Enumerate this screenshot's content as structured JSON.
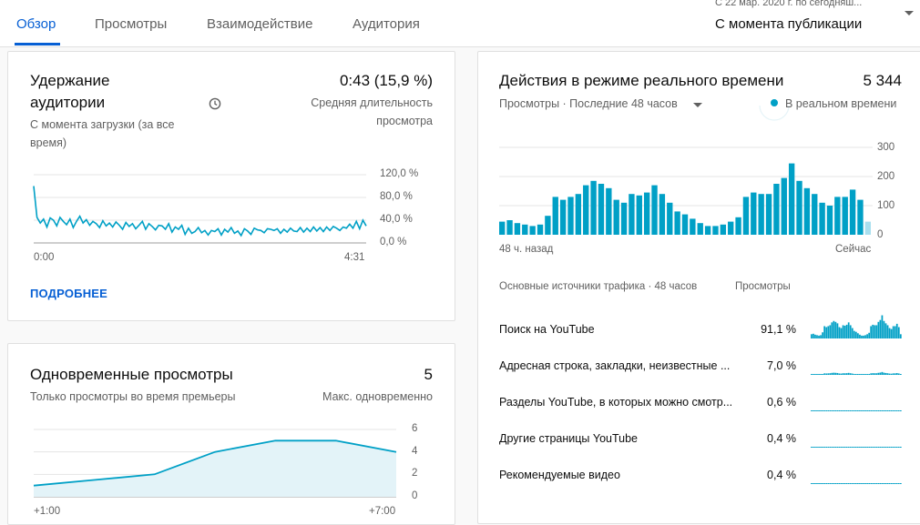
{
  "tabs": [
    {
      "label": "Обзор",
      "active": true
    },
    {
      "label": "Просмотры",
      "active": false
    },
    {
      "label": "Взаимодействие",
      "active": false
    },
    {
      "label": "Аудитория",
      "active": false
    }
  ],
  "date_range": {
    "detail": "С 22 мар. 2020 г. по сегодняш...",
    "selected": "С момента публикации"
  },
  "retention": {
    "title": "Удержание аудитории",
    "title_line1": "Удержание",
    "title_line2": "аудитории",
    "subtitle": "С момента загрузки (за все время)",
    "subtitle_line1": "С момента загрузки (за все",
    "subtitle_line2": "время)",
    "value": "0:43 (15,9 %)",
    "value_label_line1": "Средняя длительность",
    "value_label_line2": "просмотра",
    "link": "ПОДРОБНЕЕ"
  },
  "concurrent": {
    "title": "Одновременные просмотры",
    "subtitle": "Только просмотры во время премьеры",
    "value": "5",
    "value_label": "Макс. одновременно"
  },
  "realtime": {
    "title": "Действия в режиме реального времени",
    "value": "5 344",
    "filter": "Просмотры · Последние 48 часов",
    "live_label": "В реальном времени",
    "x_start": "48 ч. назад",
    "x_end": "Сейчас",
    "sources_header": "Основные источники трафика · 48 часов",
    "sources_col": "Просмотры",
    "sources": [
      {
        "name": "Поиск на YouTube",
        "value": "91,1 %"
      },
      {
        "name": "Адресная строка, закладки, неизвестные ...",
        "value": "7,0 %"
      },
      {
        "name": "Разделы YouTube, в которых можно смотр...",
        "value": "0,6 %"
      },
      {
        "name": "Другие страницы YouTube",
        "value": "0,4 %"
      },
      {
        "name": "Рекомендуемые видео",
        "value": "0,4 %"
      }
    ]
  },
  "colors": {
    "accent": "#065fd4",
    "chart": "#00a0c6",
    "chart_light": "#a9dfee",
    "area_fill": "#e3f3f8"
  },
  "chart_data": [
    {
      "type": "line",
      "title": "Удержание аудитории",
      "x_ticks": [
        "0:00",
        "4:31"
      ],
      "y_ticks": [
        "120,0 %",
        "80,0 %",
        "40,0 %",
        "0,0 %"
      ],
      "ylim": [
        0,
        120
      ],
      "grid": true,
      "series": [
        {
          "values": [
            100,
            45,
            35,
            42,
            28,
            44,
            40,
            30,
            45,
            38,
            32,
            42,
            27,
            38,
            47,
            35,
            41,
            31,
            38,
            34,
            27,
            39,
            30,
            35,
            28,
            37,
            31,
            24,
            36,
            29,
            34,
            25,
            31,
            38,
            24,
            34,
            29,
            23,
            31,
            30,
            24,
            34,
            19,
            28,
            24,
            31,
            15,
            26,
            17,
            20,
            27,
            18,
            22,
            14,
            22,
            20,
            25,
            14,
            24,
            19,
            27,
            17,
            21,
            13,
            25,
            21,
            15,
            26,
            23,
            22,
            18,
            25,
            24,
            22,
            25,
            17,
            24,
            19,
            26,
            21,
            20,
            27,
            19,
            26,
            20,
            28,
            21,
            27,
            20,
            28,
            22,
            29,
            26,
            22,
            28,
            26,
            33,
            26,
            38,
            25,
            40,
            30
          ]
        }
      ]
    },
    {
      "type": "area",
      "title": "Одновременные просмотры",
      "categories": [
        "+1:00",
        "+2:00",
        "+3:00",
        "+4:00",
        "+5:00",
        "+6:00",
        "+7:00"
      ],
      "x_ticks": [
        "+1:00",
        "+7:00"
      ],
      "y_ticks": [
        "6",
        "4",
        "2",
        "0"
      ],
      "ylim": [
        0,
        6
      ],
      "grid": true,
      "series": [
        {
          "values": [
            1,
            1.5,
            2,
            4,
            5,
            5,
            4
          ]
        }
      ]
    },
    {
      "type": "bar",
      "title": "Действия в режиме реального времени",
      "x_ticks": [
        "48 ч. назад",
        "Сейчас"
      ],
      "y_ticks": [
        "300",
        "200",
        "100",
        "0"
      ],
      "ylim": [
        0,
        300
      ],
      "grid": true,
      "last_bar_highlighted": true,
      "series": [
        {
          "values": [
            45,
            50,
            40,
            35,
            30,
            35,
            65,
            130,
            120,
            130,
            140,
            170,
            185,
            175,
            160,
            120,
            110,
            140,
            135,
            145,
            170,
            140,
            110,
            80,
            70,
            55,
            40,
            30,
            30,
            35,
            45,
            60,
            130,
            145,
            140,
            140,
            175,
            195,
            245,
            185,
            160,
            140,
            110,
            100,
            130,
            130,
            155,
            120,
            45
          ]
        }
      ]
    }
  ]
}
